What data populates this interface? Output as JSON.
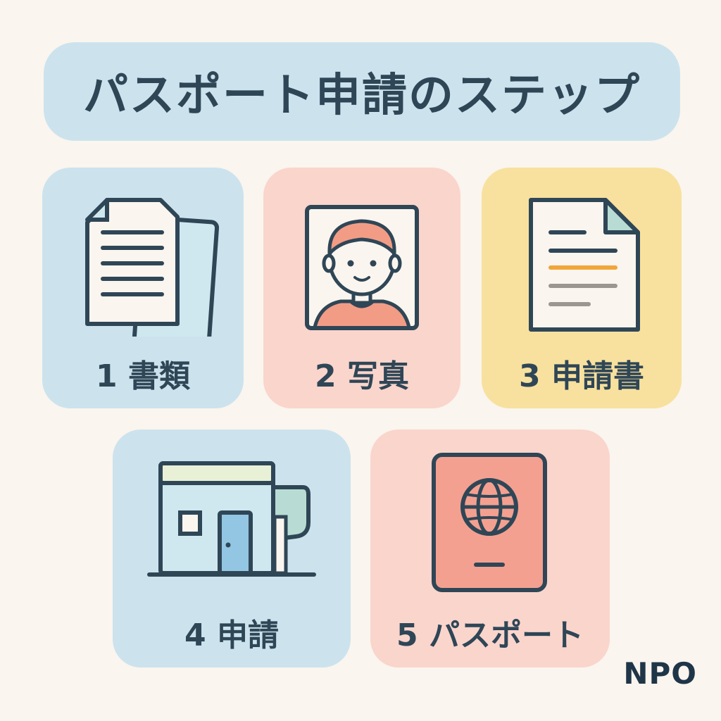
{
  "title": "パスポート申請のステップ",
  "steps": [
    {
      "label": "1 書類",
      "icon": "documents-icon",
      "color": "#cce3ee"
    },
    {
      "label": "2 写真",
      "icon": "photo-portrait-icon",
      "color": "#fad5cc"
    },
    {
      "label": "3 申請書",
      "icon": "application-form-icon",
      "color": "#f8e19e"
    },
    {
      "label": "4 申請",
      "icon": "office-building-icon",
      "color": "#cce3ee"
    },
    {
      "label": "5 パスポート",
      "icon": "passport-icon",
      "color": "#fad5cc"
    }
  ],
  "organization": "NPO",
  "colors": {
    "background": "#faf5ee",
    "text": "#2f4656",
    "accent_orange": "#f0a63a",
    "passport_red": "#f4a090"
  }
}
